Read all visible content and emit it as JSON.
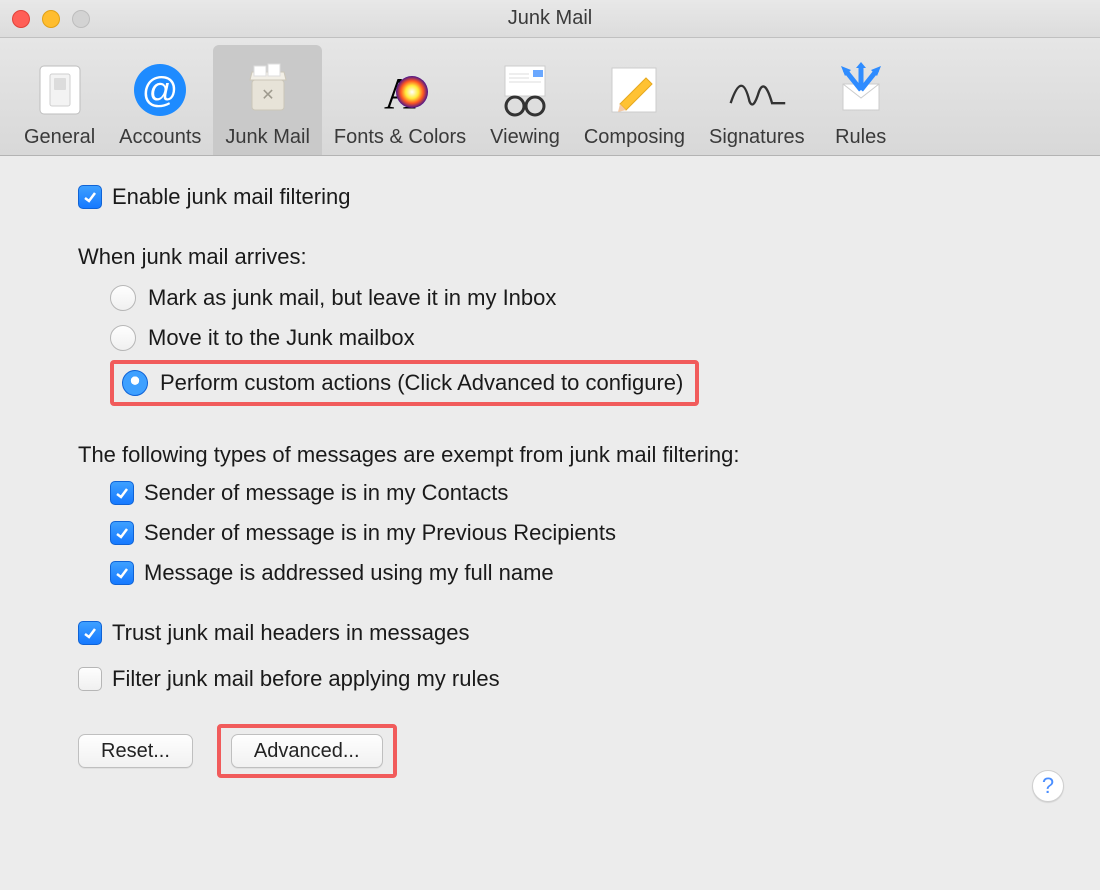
{
  "window": {
    "title": "Junk Mail"
  },
  "tabs": [
    {
      "label": "General"
    },
    {
      "label": "Accounts"
    },
    {
      "label": "Junk Mail"
    },
    {
      "label": "Fonts & Colors"
    },
    {
      "label": "Viewing"
    },
    {
      "label": "Composing"
    },
    {
      "label": "Signatures"
    },
    {
      "label": "Rules"
    }
  ],
  "enable": {
    "label": "Enable junk mail filtering",
    "checked": true
  },
  "arrives": {
    "heading": "When junk mail arrives:",
    "options": [
      {
        "label": "Mark as junk mail, but leave it in my Inbox",
        "selected": false
      },
      {
        "label": "Move it to the Junk mailbox",
        "selected": false
      },
      {
        "label": "Perform custom actions (Click Advanced to configure)",
        "selected": true
      }
    ]
  },
  "exempt": {
    "heading": "The following types of messages are exempt from junk mail filtering:",
    "items": [
      {
        "label": "Sender of message is in my Contacts",
        "checked": true
      },
      {
        "label": "Sender of message is in my Previous Recipients",
        "checked": true
      },
      {
        "label": "Message is addressed using my full name",
        "checked": true
      }
    ]
  },
  "trust": {
    "label": "Trust junk mail headers in messages",
    "checked": true
  },
  "filterBefore": {
    "label": "Filter junk mail before applying my rules",
    "checked": false
  },
  "buttons": {
    "reset": "Reset...",
    "advanced": "Advanced..."
  },
  "help": "?"
}
